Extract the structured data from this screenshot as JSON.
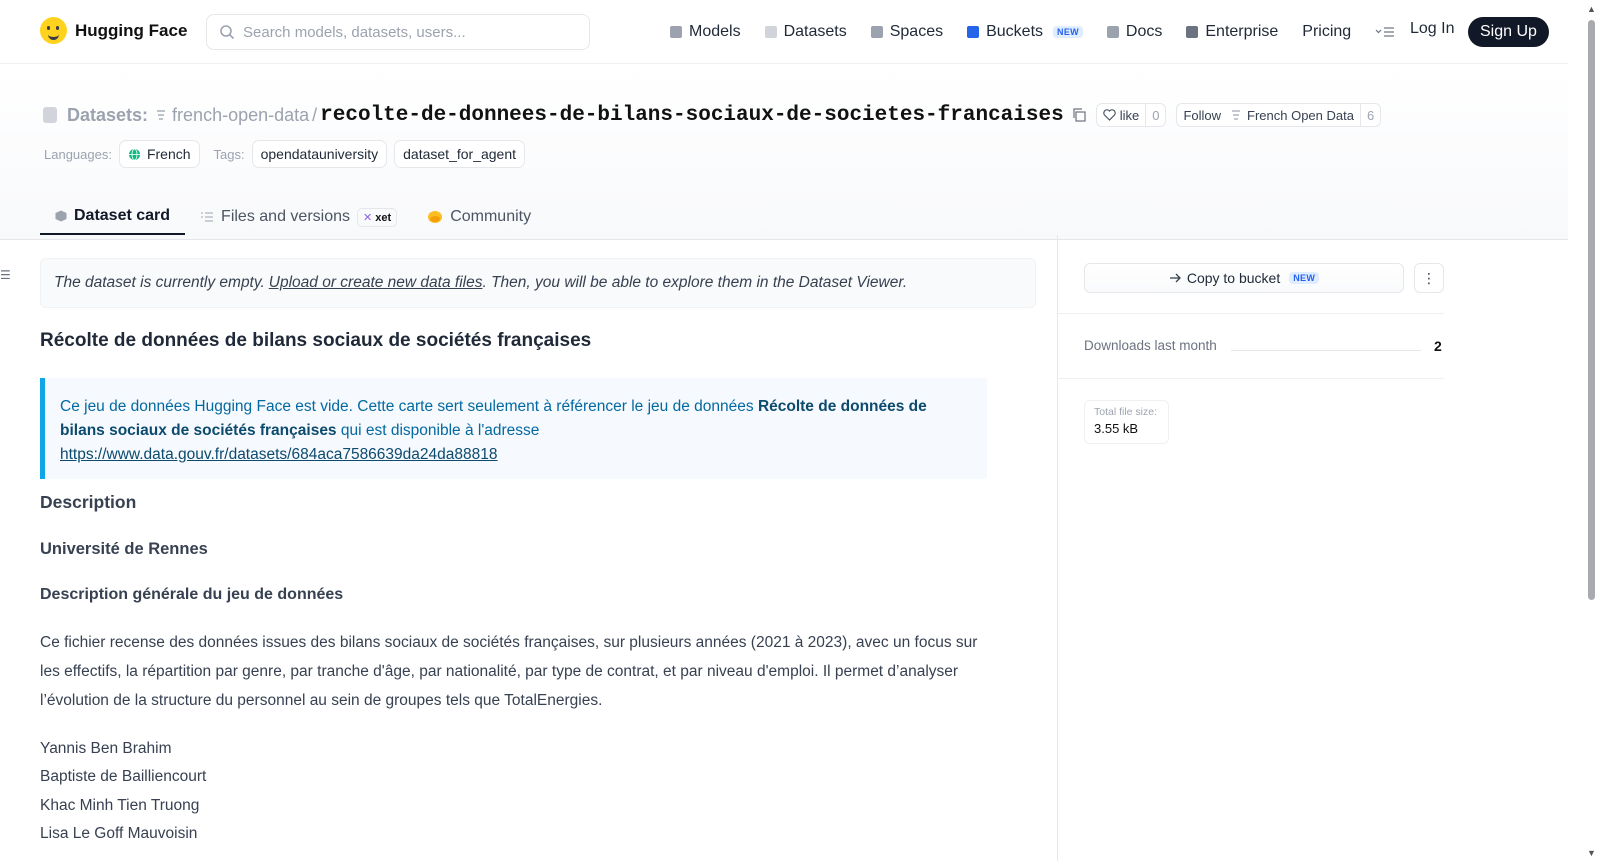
{
  "header": {
    "brand": "Hugging Face",
    "search_placeholder": "Search models, datasets, users...",
    "nav": [
      {
        "label": "Models",
        "color": "#9ca3af"
      },
      {
        "label": "Datasets",
        "color": "#d1d5db"
      },
      {
        "label": "Spaces",
        "color": "#9ca3af"
      },
      {
        "label": "Buckets",
        "color": "#2563eb",
        "badge": "NEW"
      },
      {
        "label": "Docs",
        "color": "#9ca3af"
      },
      {
        "label": "Enterprise",
        "color": "#6b7280"
      },
      {
        "label": "Pricing"
      }
    ],
    "login": "Log In",
    "signup": "Sign Up"
  },
  "repo": {
    "type_label": "Datasets:",
    "owner": "french-open-data",
    "name": "recolte-de-donnees-de-bilans-sociaux-de-societes-francaises",
    "like_label": "like",
    "like_count": "0",
    "follow_label": "Follow",
    "org_name": "French Open Data",
    "follow_count": "6",
    "languages_label": "Languages:",
    "language": "French",
    "tags_label": "Tags:",
    "tags": [
      "opendatauniversity",
      "dataset_for_agent"
    ]
  },
  "tabs": [
    {
      "label": "Dataset card",
      "active": true
    },
    {
      "label": "Files and versions",
      "badge": "xet"
    },
    {
      "label": "Community"
    }
  ],
  "card": {
    "empty_pre": "The dataset is currently empty.",
    "empty_link": "Upload or create new data files",
    "empty_post": ". Then, you will be able to explore them in the Dataset Viewer.",
    "title": "Récolte de données de bilans sociaux de sociétés françaises",
    "note_pre": "Ce jeu de données Hugging Face est vide. Cette carte sert seulement à référencer le jeu de données ",
    "note_bold": "Récolte de données de bilans sociaux de sociétés françaises",
    "note_mid": " qui est disponible à l'adresse ",
    "note_link": "https://www.data.gouv.fr/datasets/684aca7586639da24da88818",
    "h_description": "Description",
    "h_university": "Université de Rennes",
    "h_general": "Description générale du jeu de données",
    "paragraph": "Ce fichier recense des données issues des bilans sociaux de sociétés françaises, sur plusieurs années (2021 à 2023), avec un focus sur les effectifs, la répartition par genre, par tranche d'âge, par nationalité, par type de contrat, et par niveau d'emploi. Il permet d’analyser l’évolution de la structure du personnel au sein de groupes tels que TotalEnergies.",
    "authors": [
      "Yannis Ben Brahim",
      "Baptiste de Bailliencourt",
      "Khac Minh Tien Truong",
      "Lisa Le Goff Mauvoisin"
    ]
  },
  "sidebar": {
    "copy_label": "Copy to bucket",
    "copy_badge": "NEW",
    "downloads_label": "Downloads last month",
    "downloads_value": "2",
    "size_label": "Total file size:",
    "size_value": "3.55 kB"
  }
}
